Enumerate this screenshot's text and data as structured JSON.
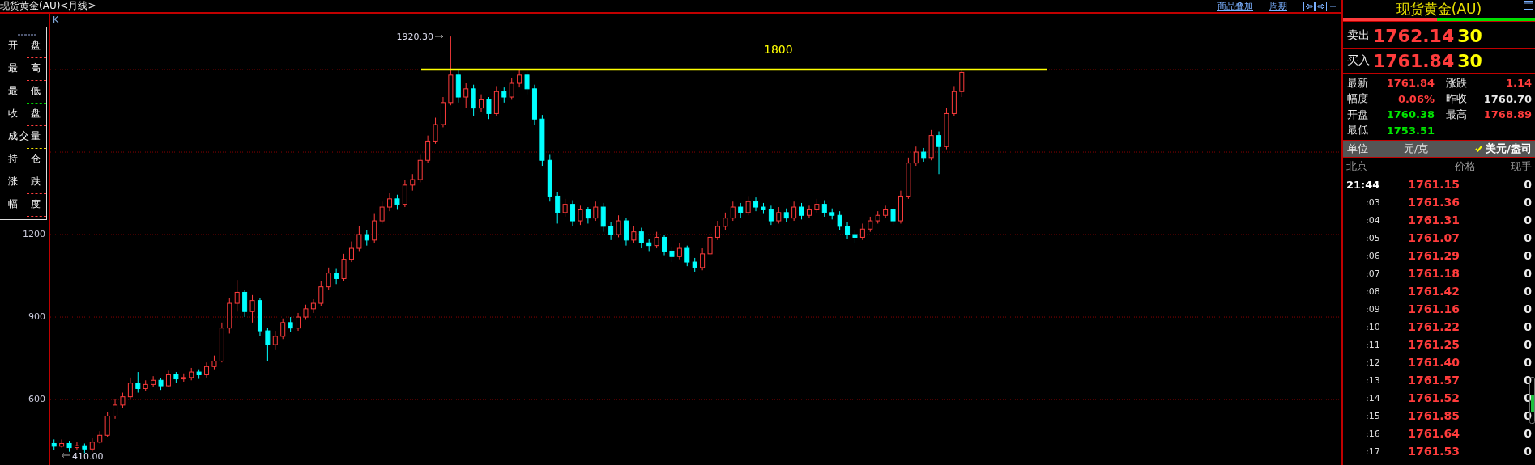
{
  "header": {
    "title": "现货黄金(AU)<月线>",
    "links": [
      "商品叠加",
      "周期"
    ]
  },
  "legend": {
    "items": [
      {
        "label": "开盘",
        "color": "#ff3c3c"
      },
      {
        "label": "最高",
        "color": "#ff3c3c"
      },
      {
        "label": "最低",
        "color": "#00d000"
      },
      {
        "label": "收盘",
        "color": "#ff3c3c"
      },
      {
        "label": "成交量",
        "color": "#f0e000"
      },
      {
        "label": "持仓",
        "color": "#f0e000"
      },
      {
        "label": "涨跌",
        "color": "#ff3c3c"
      },
      {
        "label": "幅度",
        "color": "#ff3c3c"
      }
    ]
  },
  "chart": {
    "indicator": "K",
    "peak_label": "1920.30",
    "low_label": "410.00",
    "chart_data": {
      "type": "candlestick",
      "yticks": [
        1200,
        900,
        600
      ],
      "ylim": [
        362,
        2003
      ],
      "grid": true,
      "ref_lines": [
        {
          "axis": "y",
          "value": 1800,
          "label": "1800",
          "color": "#ffff00"
        }
      ],
      "categories": [
        null,
        null,
        null,
        null,
        null,
        null,
        null,
        null,
        null,
        null,
        null,
        null,
        null,
        null,
        null,
        null,
        null,
        null,
        null,
        null,
        null,
        null,
        null,
        null,
        null,
        null,
        null,
        null,
        null,
        null,
        null,
        null,
        null,
        null,
        null,
        null,
        null,
        null,
        null,
        null,
        null,
        null,
        null,
        null,
        null,
        null,
        null,
        null,
        null,
        null,
        null,
        null,
        null,
        null,
        null,
        null,
        null,
        null,
        null,
        null,
        null,
        null,
        null,
        null,
        null,
        null,
        null,
        null,
        null,
        null,
        null,
        null,
        null,
        null,
        null,
        null,
        null,
        null,
        null,
        null,
        null,
        null,
        null,
        null,
        null,
        null,
        null,
        null,
        null,
        null,
        null,
        null,
        null,
        null,
        null,
        null,
        null,
        null,
        null,
        null,
        null,
        null,
        null,
        null,
        null,
        null,
        null,
        null,
        null,
        null,
        null,
        null,
        null,
        null,
        null,
        null,
        null,
        null,
        null,
        null
      ],
      "ohlc": [
        [
          440,
          455,
          415,
          430
        ],
        [
          430,
          455,
          425,
          440
        ],
        [
          440,
          450,
          410,
          425
        ],
        [
          425,
          447,
          418,
          432
        ],
        [
          432,
          440,
          405,
          420
        ],
        [
          420,
          460,
          410,
          445
        ],
        [
          445,
          485,
          440,
          470
        ],
        [
          470,
          555,
          465,
          540
        ],
        [
          540,
          600,
          530,
          580
        ],
        [
          580,
          625,
          570,
          610
        ],
        [
          610,
          680,
          600,
          660
        ],
        [
          660,
          700,
          625,
          640
        ],
        [
          640,
          670,
          630,
          655
        ],
        [
          655,
          685,
          645,
          670
        ],
        [
          670,
          678,
          635,
          650
        ],
        [
          650,
          705,
          645,
          690
        ],
        [
          690,
          700,
          660,
          675
        ],
        [
          675,
          695,
          665,
          680
        ],
        [
          680,
          715,
          670,
          700
        ],
        [
          700,
          710,
          675,
          690
        ],
        [
          690,
          735,
          680,
          720
        ],
        [
          720,
          760,
          710,
          740
        ],
        [
          740,
          880,
          735,
          860
        ],
        [
          860,
          970,
          840,
          950
        ],
        [
          950,
          1035,
          920,
          990
        ],
        [
          990,
          1000,
          900,
          920
        ],
        [
          920,
          980,
          880,
          960
        ],
        [
          960,
          970,
          830,
          850
        ],
        [
          850,
          860,
          740,
          800
        ],
        [
          800,
          850,
          780,
          830
        ],
        [
          830,
          895,
          820,
          880
        ],
        [
          880,
          900,
          845,
          860
        ],
        [
          860,
          915,
          850,
          900
        ],
        [
          900,
          945,
          890,
          930
        ],
        [
          930,
          965,
          915,
          950
        ],
        [
          950,
          1030,
          940,
          1010
        ],
        [
          1010,
          1080,
          1000,
          1060
        ],
        [
          1060,
          1075,
          1020,
          1040
        ],
        [
          1040,
          1130,
          1030,
          1110
        ],
        [
          1110,
          1175,
          1100,
          1150
        ],
        [
          1150,
          1230,
          1140,
          1200
        ],
        [
          1200,
          1215,
          1160,
          1180
        ],
        [
          1180,
          1275,
          1170,
          1250
        ],
        [
          1250,
          1320,
          1240,
          1300
        ],
        [
          1300,
          1350,
          1285,
          1330
        ],
        [
          1330,
          1345,
          1290,
          1310
        ],
        [
          1310,
          1400,
          1300,
          1380
        ],
        [
          1380,
          1420,
          1360,
          1400
        ],
        [
          1400,
          1490,
          1390,
          1470
        ],
        [
          1470,
          1560,
          1460,
          1540
        ],
        [
          1540,
          1625,
          1530,
          1600
        ],
        [
          1600,
          1700,
          1590,
          1680
        ],
        [
          1680,
          1920.3,
          1670,
          1780
        ],
        [
          1780,
          1800,
          1680,
          1700
        ],
        [
          1700,
          1750,
          1660,
          1730
        ],
        [
          1730,
          1745,
          1630,
          1660
        ],
        [
          1660,
          1710,
          1645,
          1690
        ],
        [
          1690,
          1700,
          1620,
          1640
        ],
        [
          1640,
          1740,
          1630,
          1720
        ],
        [
          1720,
          1735,
          1680,
          1700
        ],
        [
          1700,
          1770,
          1690,
          1750
        ],
        [
          1750,
          1800,
          1735,
          1780
        ],
        [
          1780,
          1795,
          1710,
          1730
        ],
        [
          1730,
          1745,
          1600,
          1620
        ],
        [
          1620,
          1635,
          1450,
          1470
        ],
        [
          1470,
          1490,
          1320,
          1340
        ],
        [
          1340,
          1355,
          1240,
          1280
        ],
        [
          1280,
          1330,
          1265,
          1310
        ],
        [
          1310,
          1325,
          1230,
          1250
        ],
        [
          1250,
          1305,
          1235,
          1290
        ],
        [
          1290,
          1300,
          1240,
          1260
        ],
        [
          1260,
          1320,
          1250,
          1300
        ],
        [
          1300,
          1315,
          1210,
          1230
        ],
        [
          1230,
          1245,
          1180,
          1200
        ],
        [
          1200,
          1270,
          1190,
          1250
        ],
        [
          1250,
          1260,
          1160,
          1180
        ],
        [
          1180,
          1230,
          1170,
          1210
        ],
        [
          1210,
          1225,
          1150,
          1170
        ],
        [
          1170,
          1185,
          1140,
          1160
        ],
        [
          1160,
          1210,
          1150,
          1190
        ],
        [
          1190,
          1200,
          1125,
          1140
        ],
        [
          1140,
          1155,
          1100,
          1120
        ],
        [
          1120,
          1170,
          1110,
          1150
        ],
        [
          1150,
          1160,
          1085,
          1100
        ],
        [
          1100,
          1115,
          1065,
          1080
        ],
        [
          1080,
          1150,
          1070,
          1130
        ],
        [
          1130,
          1210,
          1120,
          1190
        ],
        [
          1190,
          1250,
          1180,
          1230
        ],
        [
          1230,
          1280,
          1215,
          1260
        ],
        [
          1260,
          1320,
          1250,
          1300
        ],
        [
          1300,
          1315,
          1260,
          1280
        ],
        [
          1280,
          1340,
          1270,
          1320
        ],
        [
          1320,
          1335,
          1285,
          1300
        ],
        [
          1300,
          1315,
          1275,
          1290
        ],
        [
          1290,
          1305,
          1235,
          1250
        ],
        [
          1250,
          1300,
          1240,
          1280
        ],
        [
          1280,
          1295,
          1245,
          1260
        ],
        [
          1260,
          1320,
          1250,
          1300
        ],
        [
          1300,
          1315,
          1255,
          1270
        ],
        [
          1270,
          1305,
          1260,
          1290
        ],
        [
          1290,
          1330,
          1280,
          1310
        ],
        [
          1310,
          1325,
          1265,
          1280
        ],
        [
          1280,
          1295,
          1255,
          1270
        ],
        [
          1270,
          1285,
          1215,
          1230
        ],
        [
          1230,
          1245,
          1185,
          1200
        ],
        [
          1200,
          1215,
          1170,
          1190
        ],
        [
          1190,
          1240,
          1180,
          1220
        ],
        [
          1220,
          1265,
          1210,
          1250
        ],
        [
          1250,
          1285,
          1240,
          1270
        ],
        [
          1270,
          1305,
          1260,
          1290
        ],
        [
          1290,
          1300,
          1235,
          1250
        ],
        [
          1250,
          1360,
          1240,
          1340
        ],
        [
          1340,
          1480,
          1330,
          1460
        ],
        [
          1460,
          1520,
          1450,
          1500
        ],
        [
          1500,
          1515,
          1465,
          1480
        ],
        [
          1480,
          1580,
          1470,
          1560
        ],
        [
          1560,
          1575,
          1420,
          1520
        ],
        [
          1520,
          1660,
          1510,
          1640
        ],
        [
          1640,
          1740,
          1630,
          1720
        ],
        [
          1720,
          1800,
          1700,
          1790
        ]
      ]
    }
  },
  "quote": {
    "title": "现货黄金(AU)",
    "ratio": {
      "level": 0.49
    },
    "sell": {
      "label": "卖出",
      "price": "1762.14",
      "volume": "30"
    },
    "buy": {
      "label": "买入",
      "price": "1761.84",
      "volume": "30"
    },
    "stats": [
      {
        "label": "最新",
        "value": "1761.84",
        "color": "#ff3c3c"
      },
      {
        "label": "涨跌",
        "value": "1.14",
        "color": "#ff3c3c"
      },
      {
        "label": "幅度",
        "value": "0.06%",
        "color": "#ff3c3c"
      },
      {
        "label": "昨收",
        "value": "1760.70",
        "color": "#e8e8e8"
      },
      {
        "label": "开盘",
        "value": "1760.38",
        "color": "#00e600"
      },
      {
        "label": "最高",
        "value": "1768.89",
        "color": "#ff3c3c"
      },
      {
        "label": "最低",
        "value": "1753.51",
        "color": "#00e600"
      }
    ],
    "unit": {
      "label": "单位",
      "options": [
        {
          "label": "元/克",
          "selected": false
        },
        {
          "label": "美元/盎司",
          "selected": true
        }
      ]
    },
    "ticks": {
      "columns": [
        "北京",
        "价格",
        "现手"
      ],
      "rows": [
        {
          "time": "21:44",
          "price": "1761.15",
          "volume": "0"
        },
        {
          "time": ":03",
          "price": "1761.36",
          "volume": "0"
        },
        {
          "time": ":04",
          "price": "1761.31",
          "volume": "0"
        },
        {
          "time": ":05",
          "price": "1761.07",
          "volume": "0"
        },
        {
          "time": ":06",
          "price": "1761.29",
          "volume": "0"
        },
        {
          "time": ":07",
          "price": "1761.18",
          "volume": "0"
        },
        {
          "time": ":08",
          "price": "1761.42",
          "volume": "0"
        },
        {
          "time": ":09",
          "price": "1761.16",
          "volume": "0"
        },
        {
          "time": ":10",
          "price": "1761.22",
          "volume": "0"
        },
        {
          "time": ":11",
          "price": "1761.25",
          "volume": "0"
        },
        {
          "time": ":12",
          "price": "1761.40",
          "volume": "0"
        },
        {
          "time": ":13",
          "price": "1761.57",
          "volume": "0"
        },
        {
          "time": ":14",
          "price": "1761.52",
          "volume": "0"
        },
        {
          "time": ":15",
          "price": "1761.85",
          "volume": "0"
        },
        {
          "time": ":16",
          "price": "1761.64",
          "volume": "0"
        },
        {
          "time": ":17",
          "price": "1761.53",
          "volume": "0"
        }
      ]
    }
  }
}
